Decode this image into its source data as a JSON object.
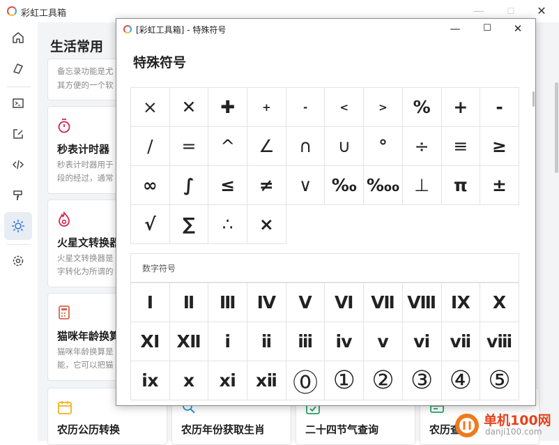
{
  "main_window": {
    "title": "彩虹工具箱",
    "controls": {
      "minimize": "—",
      "maximize": "☐",
      "close": "✕"
    }
  },
  "sidebar": {
    "items": [
      {
        "icon": "home-icon",
        "active": false
      },
      {
        "icon": "layers-icon",
        "active": false
      },
      {
        "icon": "terminal-icon",
        "active": false
      },
      {
        "icon": "edit-icon",
        "active": false
      },
      {
        "icon": "code-icon",
        "active": false
      },
      {
        "icon": "paint-roller-icon",
        "active": false
      },
      {
        "icon": "sun-icon",
        "active": true
      },
      {
        "icon": "settings-icon",
        "active": false
      }
    ]
  },
  "content": {
    "page_title": "生活常用",
    "cards": [
      {
        "title": "",
        "desc1": "备忘录功能是尤",
        "desc2": "其方便的一个软",
        "icon": "memo-icon"
      },
      {
        "title": "秒表计时器",
        "desc1": "秒表计时器用于",
        "desc2": "段的经过，通常",
        "icon": "stopwatch-icon"
      },
      {
        "title": "火星文转换器",
        "desc1": "火星文转换器是",
        "desc2": "字转化为所谓的",
        "icon": "flame-icon"
      },
      {
        "title": "猫咪年龄换算",
        "desc1": "猫咪年龄换算是",
        "desc2": "能，它可以把猫",
        "icon": "calculator-icon"
      }
    ],
    "bottom_cards": [
      {
        "title": "农历公历转换",
        "icon": "calendar-icon"
      },
      {
        "title": "农历年份获取生肖",
        "icon": "search-icon"
      },
      {
        "title": "二十四节气查询",
        "icon": "calendar-check-icon"
      },
      {
        "title": "农历查询",
        "icon": "card-icon"
      }
    ]
  },
  "watermark": {
    "line1": "单机100网",
    "line2": "danji100.com"
  },
  "dialog": {
    "title": "[彩虹工具箱] - 特殊符号",
    "heading": "特殊符号",
    "controls": {
      "minimize": "—",
      "maximize": "☐",
      "close": "✕"
    },
    "math_symbols": [
      "×",
      "✕",
      "✚",
      "+",
      "-",
      "<",
      ">",
      "%",
      "+",
      "-",
      "/",
      "=",
      "^",
      "∠",
      "∩",
      "∪",
      "°",
      "÷",
      "≡",
      "≥",
      "∞",
      "∫",
      "≤",
      "≠",
      "∨",
      "‰",
      "‱",
      "⊥",
      "π",
      "±",
      "√",
      "∑",
      "∴",
      "×"
    ],
    "number_section_label": "数字符号",
    "number_symbols": [
      "Ⅰ",
      "Ⅱ",
      "Ⅲ",
      "Ⅳ",
      "Ⅴ",
      "Ⅵ",
      "Ⅶ",
      "Ⅷ",
      "Ⅸ",
      "Ⅹ",
      "Ⅺ",
      "Ⅻ",
      "ⅰ",
      "ⅱ",
      "ⅲ",
      "ⅳ",
      "ⅴ",
      "ⅵ",
      "ⅶ",
      "ⅷ",
      "ⅸ",
      "ⅹ",
      "ⅺ",
      "ⅻ",
      "⓪",
      "①",
      "②",
      "③",
      "④",
      "⑤"
    ]
  }
}
